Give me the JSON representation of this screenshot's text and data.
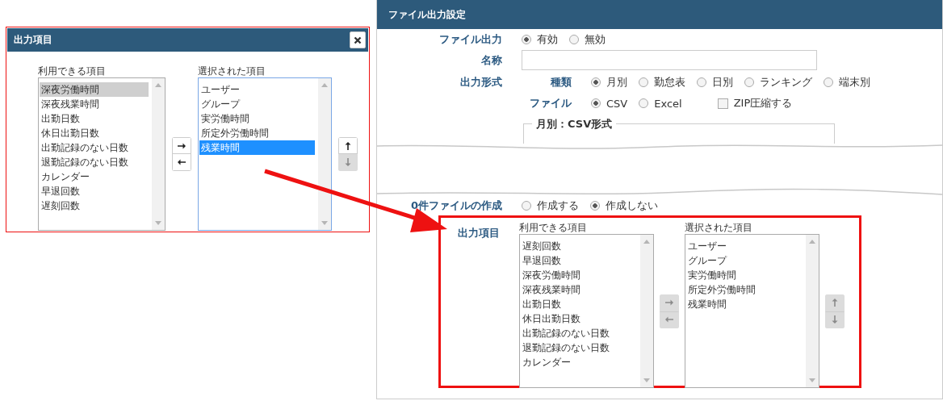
{
  "dialog": {
    "title": "出力項目",
    "available": {
      "label": "利用できる項目",
      "focused": false,
      "items": [
        {
          "text": "深夜労働時間",
          "selected": true
        },
        {
          "text": "深夜残業時間",
          "selected": false
        },
        {
          "text": "出勤日数",
          "selected": false
        },
        {
          "text": "休日出勤日数",
          "selected": false
        },
        {
          "text": "出勤記録のない日数",
          "selected": false
        },
        {
          "text": "退勤記録のない日数",
          "selected": false
        },
        {
          "text": "カレンダー",
          "selected": false
        },
        {
          "text": "早退回数",
          "selected": false
        },
        {
          "text": "遅刻回数",
          "selected": false
        }
      ]
    },
    "chosen": {
      "label": "選択された項目",
      "focused": true,
      "items": [
        {
          "text": "ユーザー",
          "selected": false
        },
        {
          "text": "グループ",
          "selected": false
        },
        {
          "text": "実労働時間",
          "selected": false
        },
        {
          "text": "所定外労働時間",
          "selected": false
        },
        {
          "text": "残業時間",
          "selected": true
        }
      ]
    },
    "transfer_buttons": [
      {
        "kind": "right",
        "disabled": false
      },
      {
        "kind": "left",
        "disabled": false
      }
    ],
    "order_buttons": [
      {
        "kind": "up",
        "disabled": false
      },
      {
        "kind": "down",
        "disabled": true
      }
    ]
  },
  "panel": {
    "title": "ファイル出力設定",
    "file_output": {
      "label": "ファイル出力",
      "options": [
        {
          "label": "有効",
          "selected": true
        },
        {
          "label": "無効",
          "selected": false
        }
      ]
    },
    "name": {
      "label": "名称"
    },
    "format": {
      "label": "出力形式",
      "type": {
        "label": "種類",
        "options": [
          {
            "label": "月別",
            "selected": true
          },
          {
            "label": "勤怠表",
            "selected": false
          },
          {
            "label": "日別",
            "selected": false
          },
          {
            "label": "ランキング",
            "selected": false
          },
          {
            "label": "端末別",
            "selected": false
          }
        ]
      },
      "file": {
        "label": "ファイル",
        "options": [
          {
            "label": "CSV",
            "selected": true
          },
          {
            "label": "Excel",
            "selected": false
          }
        ],
        "zip": {
          "label": "ZIP圧縮する",
          "checked": false
        }
      }
    },
    "fieldset": {
      "legend": "月別：CSV形式"
    },
    "empty_file": {
      "label": "0件ファイルの作成",
      "options": [
        {
          "label": "作成する",
          "selected": false
        },
        {
          "label": "作成しない",
          "selected": true
        }
      ]
    },
    "items": {
      "label": "出力項目",
      "available": {
        "label": "利用できる項目",
        "focused": false,
        "items": [
          {
            "text": "遅刻回数",
            "selected": false
          },
          {
            "text": "早退回数",
            "selected": false
          },
          {
            "text": "深夜労働時間",
            "selected": false
          },
          {
            "text": "深夜残業時間",
            "selected": false
          },
          {
            "text": "出勤日数",
            "selected": false
          },
          {
            "text": "休日出勤日数",
            "selected": false
          },
          {
            "text": "出勤記録のない日数",
            "selected": false
          },
          {
            "text": "退勤記録のない日数",
            "selected": false
          },
          {
            "text": "カレンダー",
            "selected": false
          }
        ]
      },
      "chosen": {
        "label": "選択された項目",
        "focused": false,
        "items": [
          {
            "text": "ユーザー",
            "selected": false
          },
          {
            "text": "グループ",
            "selected": false
          },
          {
            "text": "実労働時間",
            "selected": false
          },
          {
            "text": "所定外労働時間",
            "selected": false
          },
          {
            "text": "残業時間",
            "selected": false
          }
        ]
      },
      "transfer_buttons": [
        {
          "kind": "right",
          "disabled": true
        },
        {
          "kind": "left",
          "disabled": true
        }
      ],
      "order_buttons": [
        {
          "kind": "up",
          "disabled": true
        },
        {
          "kind": "down",
          "disabled": true
        }
      ]
    }
  }
}
